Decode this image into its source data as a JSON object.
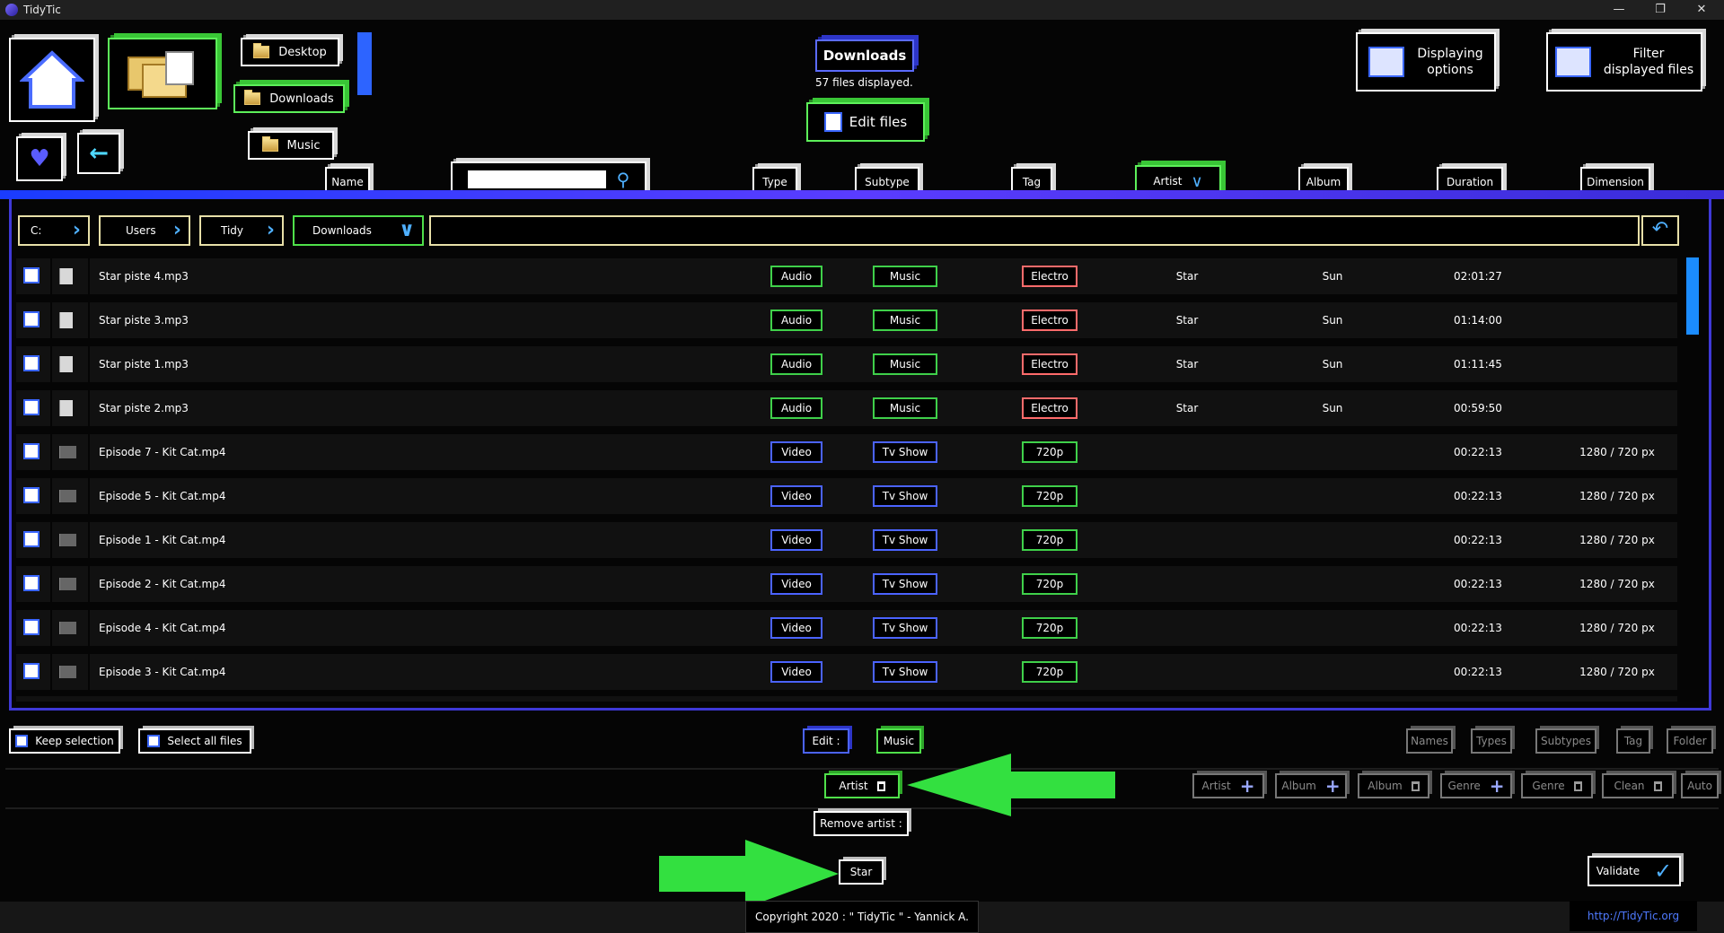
{
  "window": {
    "title": "TidyTic",
    "min": "—",
    "max": "❐",
    "close": "✕"
  },
  "quick_folders": {
    "desktop": "Desktop",
    "downloads": "Downloads",
    "music": "Music"
  },
  "current_folder": {
    "name": "Downloads",
    "count_text": "57 files displayed.",
    "edit_label": "Edit files"
  },
  "top_right": {
    "display_options": [
      "Displaying",
      "options"
    ],
    "filter": [
      "Filter",
      "displayed files"
    ]
  },
  "columns": {
    "name": "Name",
    "type": "Type",
    "subtype": "Subtype",
    "tag": "Tag",
    "artist": "Artist",
    "album": "Album",
    "duration": "Duration",
    "dimension": "Dimension",
    "search_value": ""
  },
  "breadcrumb": [
    "C:",
    "Users",
    "Tidy",
    "Downloads"
  ],
  "rows": [
    {
      "name": "Star piste 4.mp3",
      "type": "Audio",
      "subtype": "Music",
      "tag": "Electro",
      "artist": "Star",
      "album": "Sun",
      "duration": "02:01:27",
      "dimension": "",
      "kind": "audio"
    },
    {
      "name": "Star piste 3.mp3",
      "type": "Audio",
      "subtype": "Music",
      "tag": "Electro",
      "artist": "Star",
      "album": "Sun",
      "duration": "01:14:00",
      "dimension": "",
      "kind": "audio"
    },
    {
      "name": "Star piste 1.mp3",
      "type": "Audio",
      "subtype": "Music",
      "tag": "Electro",
      "artist": "Star",
      "album": "Sun",
      "duration": "01:11:45",
      "dimension": "",
      "kind": "audio"
    },
    {
      "name": "Star piste 2.mp3",
      "type": "Audio",
      "subtype": "Music",
      "tag": "Electro",
      "artist": "Star",
      "album": "Sun",
      "duration": "00:59:50",
      "dimension": "",
      "kind": "audio"
    },
    {
      "name": "Episode 7 - Kit Cat.mp4",
      "type": "Video",
      "subtype": "Tv Show",
      "tag": "720p",
      "artist": "",
      "album": "",
      "duration": "00:22:13",
      "dimension": "1280 / 720 px",
      "kind": "video"
    },
    {
      "name": "Episode 5 - Kit Cat.mp4",
      "type": "Video",
      "subtype": "Tv Show",
      "tag": "720p",
      "artist": "",
      "album": "",
      "duration": "00:22:13",
      "dimension": "1280 / 720 px",
      "kind": "video"
    },
    {
      "name": "Episode 1 - Kit Cat.mp4",
      "type": "Video",
      "subtype": "Tv Show",
      "tag": "720p",
      "artist": "",
      "album": "",
      "duration": "00:22:13",
      "dimension": "1280 / 720 px",
      "kind": "video"
    },
    {
      "name": "Episode 2 - Kit Cat.mp4",
      "type": "Video",
      "subtype": "Tv Show",
      "tag": "720p",
      "artist": "",
      "album": "",
      "duration": "00:22:13",
      "dimension": "1280 / 720 px",
      "kind": "video"
    },
    {
      "name": "Episode 4 - Kit Cat.mp4",
      "type": "Video",
      "subtype": "Tv Show",
      "tag": "720p",
      "artist": "",
      "album": "",
      "duration": "00:22:13",
      "dimension": "1280 / 720 px",
      "kind": "video"
    },
    {
      "name": "Episode 3 - Kit Cat.mp4",
      "type": "Video",
      "subtype": "Tv Show",
      "tag": "720p",
      "artist": "",
      "album": "",
      "duration": "00:22:13",
      "dimension": "1280 / 720 px",
      "kind": "video"
    }
  ],
  "bottom": {
    "keep_selection": "Keep selection",
    "select_all": "Select all files",
    "edit": "Edit :",
    "edit_value": "Music",
    "filters": [
      "Names",
      "Types",
      "Subtypes",
      "Tag",
      "Folder"
    ],
    "artist_chip": "Artist",
    "actions": [
      "Artist",
      "Album",
      "Album",
      "Genre",
      "Genre",
      "Clean",
      "Auto"
    ],
    "remove_artist": "Remove artist :",
    "star": "Star",
    "validate": "Validate",
    "copyright": "Copyright 2020 : \" TidyTic \" - Yannick A.",
    "url": "http://TidyTic.org"
  },
  "colors": {
    "accent_blue": "#3f39d8",
    "green": "#4fe04a",
    "red": "#ff6b6b",
    "arrow": "#33e040"
  }
}
